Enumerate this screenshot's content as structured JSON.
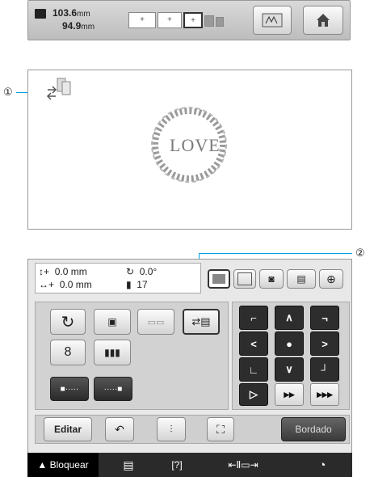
{
  "top_bar": {
    "width_value": "103.6",
    "height_value": "94.9",
    "unit": "mm",
    "hoop_labels": [
      "+",
      "+",
      "+"
    ]
  },
  "callouts": {
    "one": "①",
    "two": "②"
  },
  "preview": {
    "design_text": "LOVE"
  },
  "info": {
    "x_offset": "0.0",
    "y_offset": "0.0",
    "angle": "0.0°",
    "unit": "mm",
    "colors": "17",
    "x_sign": "↕+",
    "y_sign": "↔+"
  },
  "bottom_buttons": {
    "edit": "Editar",
    "embroider": "Bordado"
  },
  "status_bar": {
    "lock": "Bloquear"
  },
  "arrow_pad": {
    "up_left": "⌐",
    "up": "∧",
    "up_right": "¬",
    "left": "<",
    "center": "●",
    "right": ">",
    "down_left": "∟",
    "down": "∨",
    "down_right": "┘",
    "play": "▷",
    "ff": "▸▸",
    "fff": "▸▸▸"
  }
}
